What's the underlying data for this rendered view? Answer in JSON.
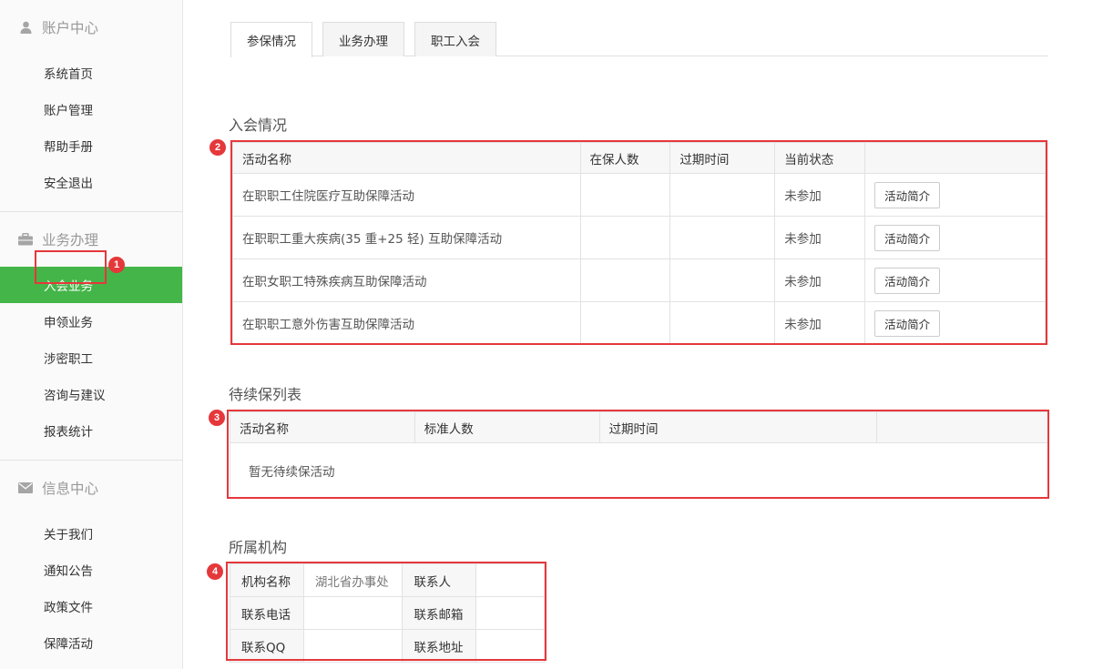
{
  "sidebar": {
    "account": {
      "title": "账户中心",
      "icon": "user-icon",
      "items": [
        "系统首页",
        "账户管理",
        "帮助手册",
        "安全退出"
      ]
    },
    "business": {
      "title": "业务办理",
      "icon": "briefcase-icon",
      "items": [
        "入会业务",
        "申领业务",
        "涉密职工",
        "咨询与建议",
        "报表统计"
      ],
      "active_index": 0
    },
    "info": {
      "title": "信息中心",
      "icon": "envelope-icon",
      "items": [
        "关于我们",
        "通知公告",
        "政策文件",
        "保障活动"
      ]
    }
  },
  "tabs": [
    {
      "label": "参保情况",
      "active": true
    },
    {
      "label": "业务办理",
      "active": false
    },
    {
      "label": "职工入会",
      "active": false
    }
  ],
  "membership": {
    "title": "入会情况",
    "headers": [
      "活动名称",
      "在保人数",
      "过期时间",
      "当前状态",
      ""
    ],
    "rows": [
      {
        "name": "在职职工住院医疗互助保障活动",
        "insured": "",
        "expiry": "",
        "status": "未参加",
        "action": "活动简介"
      },
      {
        "name": "在职职工重大疾病(35 重+25 轻) 互助保障活动",
        "insured": "",
        "expiry": "",
        "status": "未参加",
        "action": "活动简介"
      },
      {
        "name": "在职女职工特殊疾病互助保障活动",
        "insured": "",
        "expiry": "",
        "status": "未参加",
        "action": "活动简介"
      },
      {
        "name": "在职职工意外伤害互助保障活动",
        "insured": "",
        "expiry": "",
        "status": "未参加",
        "action": "活动简介"
      }
    ]
  },
  "pending": {
    "title": "待续保列表",
    "headers": [
      "活动名称",
      "标准人数",
      "过期时间",
      ""
    ],
    "empty_text": "暂无待续保活动"
  },
  "org": {
    "title": "所属机构",
    "rows": [
      {
        "k1": "机构名称",
        "v1": "湖北省办事处",
        "k2": "联系人",
        "v2": ""
      },
      {
        "k1": "联系电话",
        "v1": "",
        "k2": "联系邮箱",
        "v2": ""
      },
      {
        "k1": "联系QQ",
        "v1": "",
        "k2": "联系地址",
        "v2": ""
      }
    ]
  },
  "annotations": [
    "1",
    "2",
    "3",
    "4"
  ],
  "colors": {
    "active_green": "#44b549",
    "status_red": "#d0021b",
    "highlight_red": "#e5383b"
  }
}
